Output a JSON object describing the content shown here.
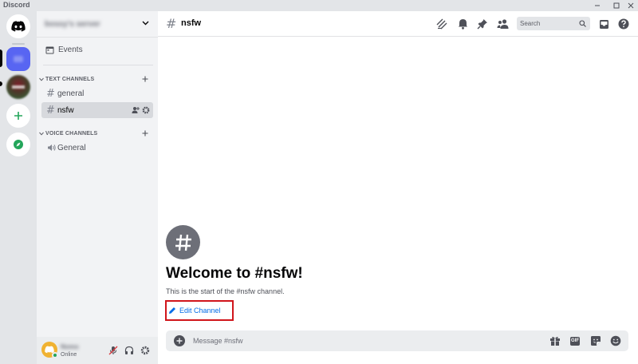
{
  "window": {
    "title": "Discord",
    "controls": [
      "minimize",
      "maximize",
      "close"
    ]
  },
  "server_rail": {
    "items": [
      {
        "name": "home",
        "icon": "discord-logo-icon"
      },
      {
        "name": "server-active",
        "icon": "server-icon",
        "color": "#5865f2"
      },
      {
        "name": "server-other",
        "icon": "server-image-icon"
      },
      {
        "name": "add-server",
        "icon": "plus-icon",
        "color": "#23a55a"
      },
      {
        "name": "explore",
        "icon": "compass-icon",
        "color": "#23a55a"
      }
    ]
  },
  "sidebar": {
    "server_name": "bossy's server",
    "events_label": "Events",
    "categories": [
      {
        "label": "TEXT CHANNELS",
        "channels": [
          {
            "name": "general",
            "active": false
          },
          {
            "name": "nsfw",
            "active": true
          }
        ]
      },
      {
        "label": "VOICE CHANNELS",
        "channels": [
          {
            "name": "General",
            "active": false
          }
        ]
      }
    ]
  },
  "user_panel": {
    "username": "Nomo",
    "status": "Online",
    "status_color": "#23a55a"
  },
  "header": {
    "channel_name": "nsfw",
    "search_placeholder": "Search",
    "icons": [
      "threads-icon",
      "bell-icon",
      "pin-icon",
      "members-icon",
      "inbox-icon",
      "help-icon"
    ]
  },
  "welcome": {
    "title": "Welcome to #nsfw!",
    "subtitle": "This is the start of the #nsfw channel.",
    "edit_label": "Edit Channel"
  },
  "composer": {
    "placeholder": "Message #nsfw",
    "icons": [
      "gift-icon",
      "gif-icon",
      "sticker-icon",
      "emoji-icon"
    ],
    "gif_label": "GIF"
  },
  "colors": {
    "accent": "#5865f2",
    "link": "#006ce7",
    "highlight_box": "#d0151b",
    "online": "#23a55a"
  }
}
